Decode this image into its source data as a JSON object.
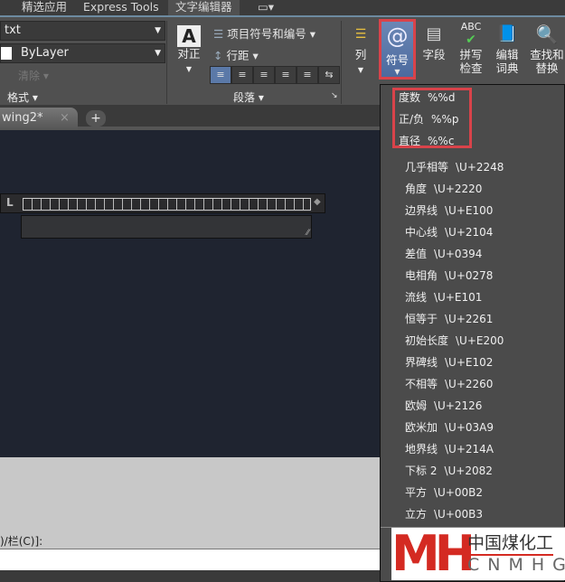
{
  "ribbon_tabs": [
    "精选应用",
    "Express Tools",
    "文字编辑器"
  ],
  "style": {
    "font_value": "txt",
    "color_value": "ByLayer",
    "clear_label": "清除",
    "panel_title": "格式"
  },
  "paragraph": {
    "justify_label": "对正",
    "bullets_label": "项目符号和编号",
    "linespacing_label": "行距",
    "panel_title": "段落"
  },
  "insert": {
    "columns_label": "列",
    "symbol_label": "符号",
    "field_label": "字段",
    "spell_label": "拼写\n检查",
    "spell_l1": "拼写",
    "spell_l2": "检查",
    "dict_l1": "编辑",
    "dict_l2": "词典",
    "find_l1": "查找和",
    "find_l2": "替换",
    "abc": "ABC"
  },
  "doc_tab": {
    "label": "wing2*",
    "close": "×",
    "add": "+"
  },
  "command": {
    "prompt": ")/栏(C)]:"
  },
  "symbol_menu": {
    "highlighted": [
      {
        "name": "度数",
        "code": "%%d"
      },
      {
        "name": "正/负",
        "code": "%%p"
      },
      {
        "name": "直径",
        "code": "%%c"
      }
    ],
    "items": [
      {
        "name": "几乎相等",
        "code": "\\U+2248"
      },
      {
        "name": "角度",
        "code": "\\U+2220"
      },
      {
        "name": "边界线",
        "code": "\\U+E100"
      },
      {
        "name": "中心线",
        "code": "\\U+2104"
      },
      {
        "name": "差值",
        "code": "\\U+0394"
      },
      {
        "name": "电相角",
        "code": "\\U+0278"
      },
      {
        "name": "流线",
        "code": "\\U+E101"
      },
      {
        "name": "恒等于",
        "code": "\\U+2261"
      },
      {
        "name": "初始长度",
        "code": "\\U+E200"
      },
      {
        "name": "界碑线",
        "code": "\\U+E102"
      },
      {
        "name": "不相等",
        "code": "\\U+2260"
      },
      {
        "name": "欧姆",
        "code": "\\U+2126"
      },
      {
        "name": "欧米加",
        "code": "\\U+03A9"
      },
      {
        "name": "地界线",
        "code": "\\U+214A"
      },
      {
        "name": "下标 2",
        "code": "\\U+2082"
      },
      {
        "name": "平方",
        "code": "\\U+00B2"
      },
      {
        "name": "立方",
        "code": "\\U+00B3"
      }
    ]
  },
  "watermark": {
    "cn": "中国煤化工",
    "en": "CNMHG"
  },
  "colors": {
    "highlight": "#d9434a",
    "accent": "#4c6a9e"
  }
}
